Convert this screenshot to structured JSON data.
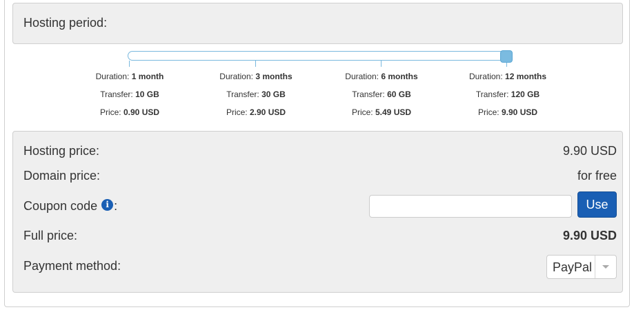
{
  "hosting_period": {
    "label": "Hosting period:",
    "selected_index": 3,
    "options": [
      {
        "duration_label": "Duration:",
        "duration": "1 month",
        "transfer_label": "Transfer:",
        "transfer": "10 GB",
        "price_label": "Price:",
        "price": "0.90 USD"
      },
      {
        "duration_label": "Duration:",
        "duration": "3 months",
        "transfer_label": "Transfer:",
        "transfer": "30 GB",
        "price_label": "Price:",
        "price": "2.90 USD"
      },
      {
        "duration_label": "Duration:",
        "duration": "6 months",
        "transfer_label": "Transfer:",
        "transfer": "60 GB",
        "price_label": "Price:",
        "price": "5.49 USD"
      },
      {
        "duration_label": "Duration:",
        "duration": "12 months",
        "transfer_label": "Transfer:",
        "transfer": "120 GB",
        "price_label": "Price:",
        "price": "9.90 USD"
      }
    ]
  },
  "summary": {
    "hosting_price_label": "Hosting price:",
    "hosting_price_value": "9.90 USD",
    "domain_price_label": "Domain price:",
    "domain_price_value": "for free",
    "coupon_label": "Coupon code",
    "coupon_colon": ":",
    "coupon_info_icon": "info-icon",
    "coupon_value": "",
    "coupon_placeholder": "",
    "use_button_label": "Use",
    "full_price_label": "Full price:",
    "full_price_value": "9.90 USD",
    "payment_method_label": "Payment method:",
    "payment_method_value": "PayPal"
  },
  "colors": {
    "accent": "#1a5fb4",
    "slider": "#7bbbe0",
    "panel_bg": "#efefef"
  }
}
